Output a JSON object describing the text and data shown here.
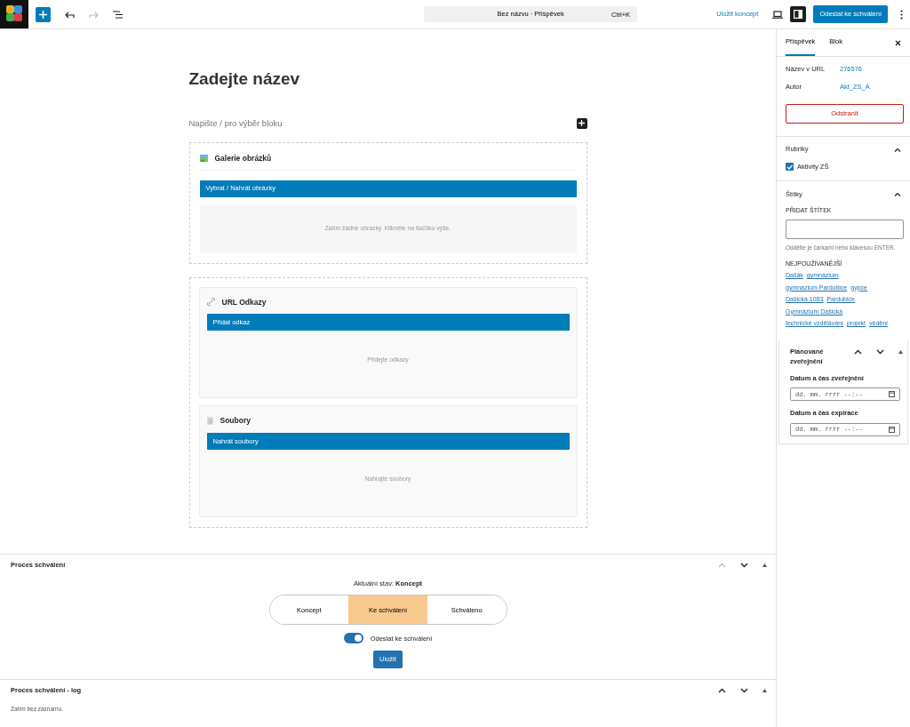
{
  "topbar": {
    "undo": {
      "disabled": false
    },
    "redo": {
      "disabled": true
    },
    "document_title": "Bez názvu · Příspěvek",
    "shortcut": "Ctrl+K",
    "save_draft": "Uložit koncept",
    "settings": {
      "pressed": true
    },
    "submit": "Odeslat ke schválení"
  },
  "editor": {
    "title_placeholder": "Zadejte název",
    "block_placeholder": "Napište / pro výběr bloku",
    "blocks": [
      {
        "kind": "gallery",
        "title": "Galerie obrázků",
        "button": "Vybrat / Nahrát obrázky",
        "empty": "Zatím žádné obrázky. Klikněte na tlačítko výše."
      },
      {
        "kind": "group",
        "children": [
          {
            "kind": "links",
            "title": "URL Odkazy",
            "button": "Přidat odkaz",
            "empty": "Přidejte odkazy"
          },
          {
            "kind": "files",
            "title": "Soubory",
            "button": "Nahrát soubory",
            "empty": "Nahrajte soubory"
          }
        ]
      }
    ]
  },
  "sidebar": {
    "tabs": [
      {
        "label": "Příspěvek",
        "selected": true
      },
      {
        "label": "Blok",
        "selected": false
      }
    ],
    "meta": [
      {
        "label": "Název v URL",
        "value": "276576"
      },
      {
        "label": "Autor",
        "value": "Akt_ZS_A"
      }
    ],
    "delete_button": "Odstranit",
    "categories": {
      "title": "Rubriky",
      "expanded": true,
      "items": [
        {
          "label": "Aktivity ZŠ",
          "checked": true
        }
      ]
    },
    "tags": {
      "title": "Štítky",
      "expanded": true,
      "add_label": "PŘIDAT ŠTÍTEK",
      "help": "Oddělte je čárkami nebo klávesou ENTER.",
      "popular_label": "NEJPOUŽÍVANĚJŠÍ",
      "popular_rows": [
        [
          "Dašák",
          "gymnázium"
        ],
        [
          "gymnázium Pardubice",
          "gypce"
        ],
        [
          "Dašická 1083",
          "Pardubice"
        ],
        [
          "Gymnázium Dašická"
        ],
        [
          "technické vzdělávání",
          "projekt",
          "vědění"
        ]
      ]
    },
    "schedule": {
      "title": "Plánované zveřejnění",
      "move_up_disabled": false,
      "fields": [
        {
          "label": "Datum a čas zveřejnění",
          "placeholder": "dd. mm. rrrr --:--"
        },
        {
          "label": "Datum a čas expirace",
          "placeholder": "dd. mm. rrrr --:--"
        }
      ]
    }
  },
  "panels": [
    {
      "kind": "approval",
      "title": "Proces schválení",
      "move_up_disabled": true,
      "status": "Aktuální stav: **Koncept**",
      "options": [
        {
          "label": "Koncept",
          "selected": false
        },
        {
          "label": "Ke schválení",
          "selected": true
        },
        {
          "label": "Schváleno",
          "selected": false
        }
      ],
      "toggle": {
        "label": "Odeslat ke schválení",
        "on": true
      },
      "save_button": "Uložit"
    },
    {
      "kind": "log",
      "title": "Proces schválení - log",
      "move_up_disabled": false,
      "empty": "Zatím bez záznamu."
    }
  ]
}
